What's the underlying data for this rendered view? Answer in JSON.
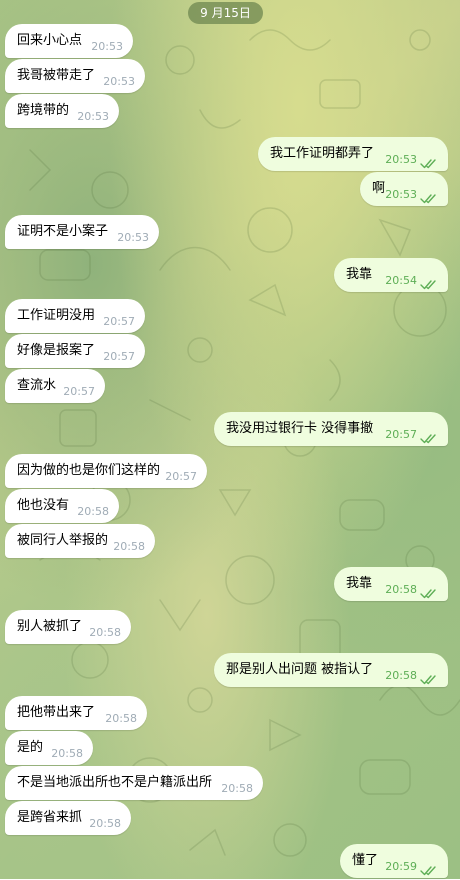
{
  "date_label": "9 月15日",
  "colors": {
    "incoming_bubble": "#ffffff",
    "outgoing_bubble": "#effdde",
    "incoming_time": "#a0acb6",
    "outgoing_time": "#5eae56",
    "date_pill": "#6e8750"
  },
  "messages": [
    {
      "dir": "in",
      "text": "回来小心点",
      "time": "20:53"
    },
    {
      "dir": "in",
      "text": "我哥被带走了",
      "time": "20:53"
    },
    {
      "dir": "in",
      "text": "跨境带的",
      "time": "20:53"
    },
    {
      "dir": "out",
      "text": "我工作证明都弄了",
      "time": "20:53",
      "status_icon": "double-check-icon"
    },
    {
      "dir": "out",
      "text": "啊",
      "time": "20:53",
      "status_icon": "double-check-icon"
    },
    {
      "dir": "in",
      "text": "证明不是小案子",
      "time": "20:53"
    },
    {
      "dir": "out",
      "text": "我靠",
      "time": "20:54",
      "status_icon": "double-check-icon"
    },
    {
      "dir": "in",
      "text": "工作证明没用",
      "time": "20:57"
    },
    {
      "dir": "in",
      "text": "好像是报案了",
      "time": "20:57"
    },
    {
      "dir": "in",
      "text": "查流水",
      "time": "20:57"
    },
    {
      "dir": "out",
      "text": "我没用过银行卡 没得事撤",
      "time": "20:57",
      "status_icon": "double-check-icon"
    },
    {
      "dir": "in",
      "text": "因为做的也是你们这样的",
      "time": "20:57"
    },
    {
      "dir": "in",
      "text": "他也没有",
      "time": "20:58"
    },
    {
      "dir": "in",
      "text": "被同行人举报的",
      "time": "20:58"
    },
    {
      "dir": "out",
      "text": "我靠",
      "time": "20:58",
      "status_icon": "double-check-icon"
    },
    {
      "dir": "in",
      "text": "别人被抓了",
      "time": "20:58"
    },
    {
      "dir": "out",
      "text": "那是别人出问题 被指认了",
      "time": "20:58",
      "status_icon": "double-check-icon"
    },
    {
      "dir": "in",
      "text": "把他带出来了",
      "time": "20:58"
    },
    {
      "dir": "in",
      "text": "是的",
      "time": "20:58"
    },
    {
      "dir": "in",
      "text": "不是当地派出所也不是户籍派出所",
      "time": "20:58"
    },
    {
      "dir": "in",
      "text": "是跨省来抓",
      "time": "20:58"
    },
    {
      "dir": "out",
      "text": "懂了",
      "time": "20:59",
      "status_icon": "double-check-icon"
    }
  ]
}
